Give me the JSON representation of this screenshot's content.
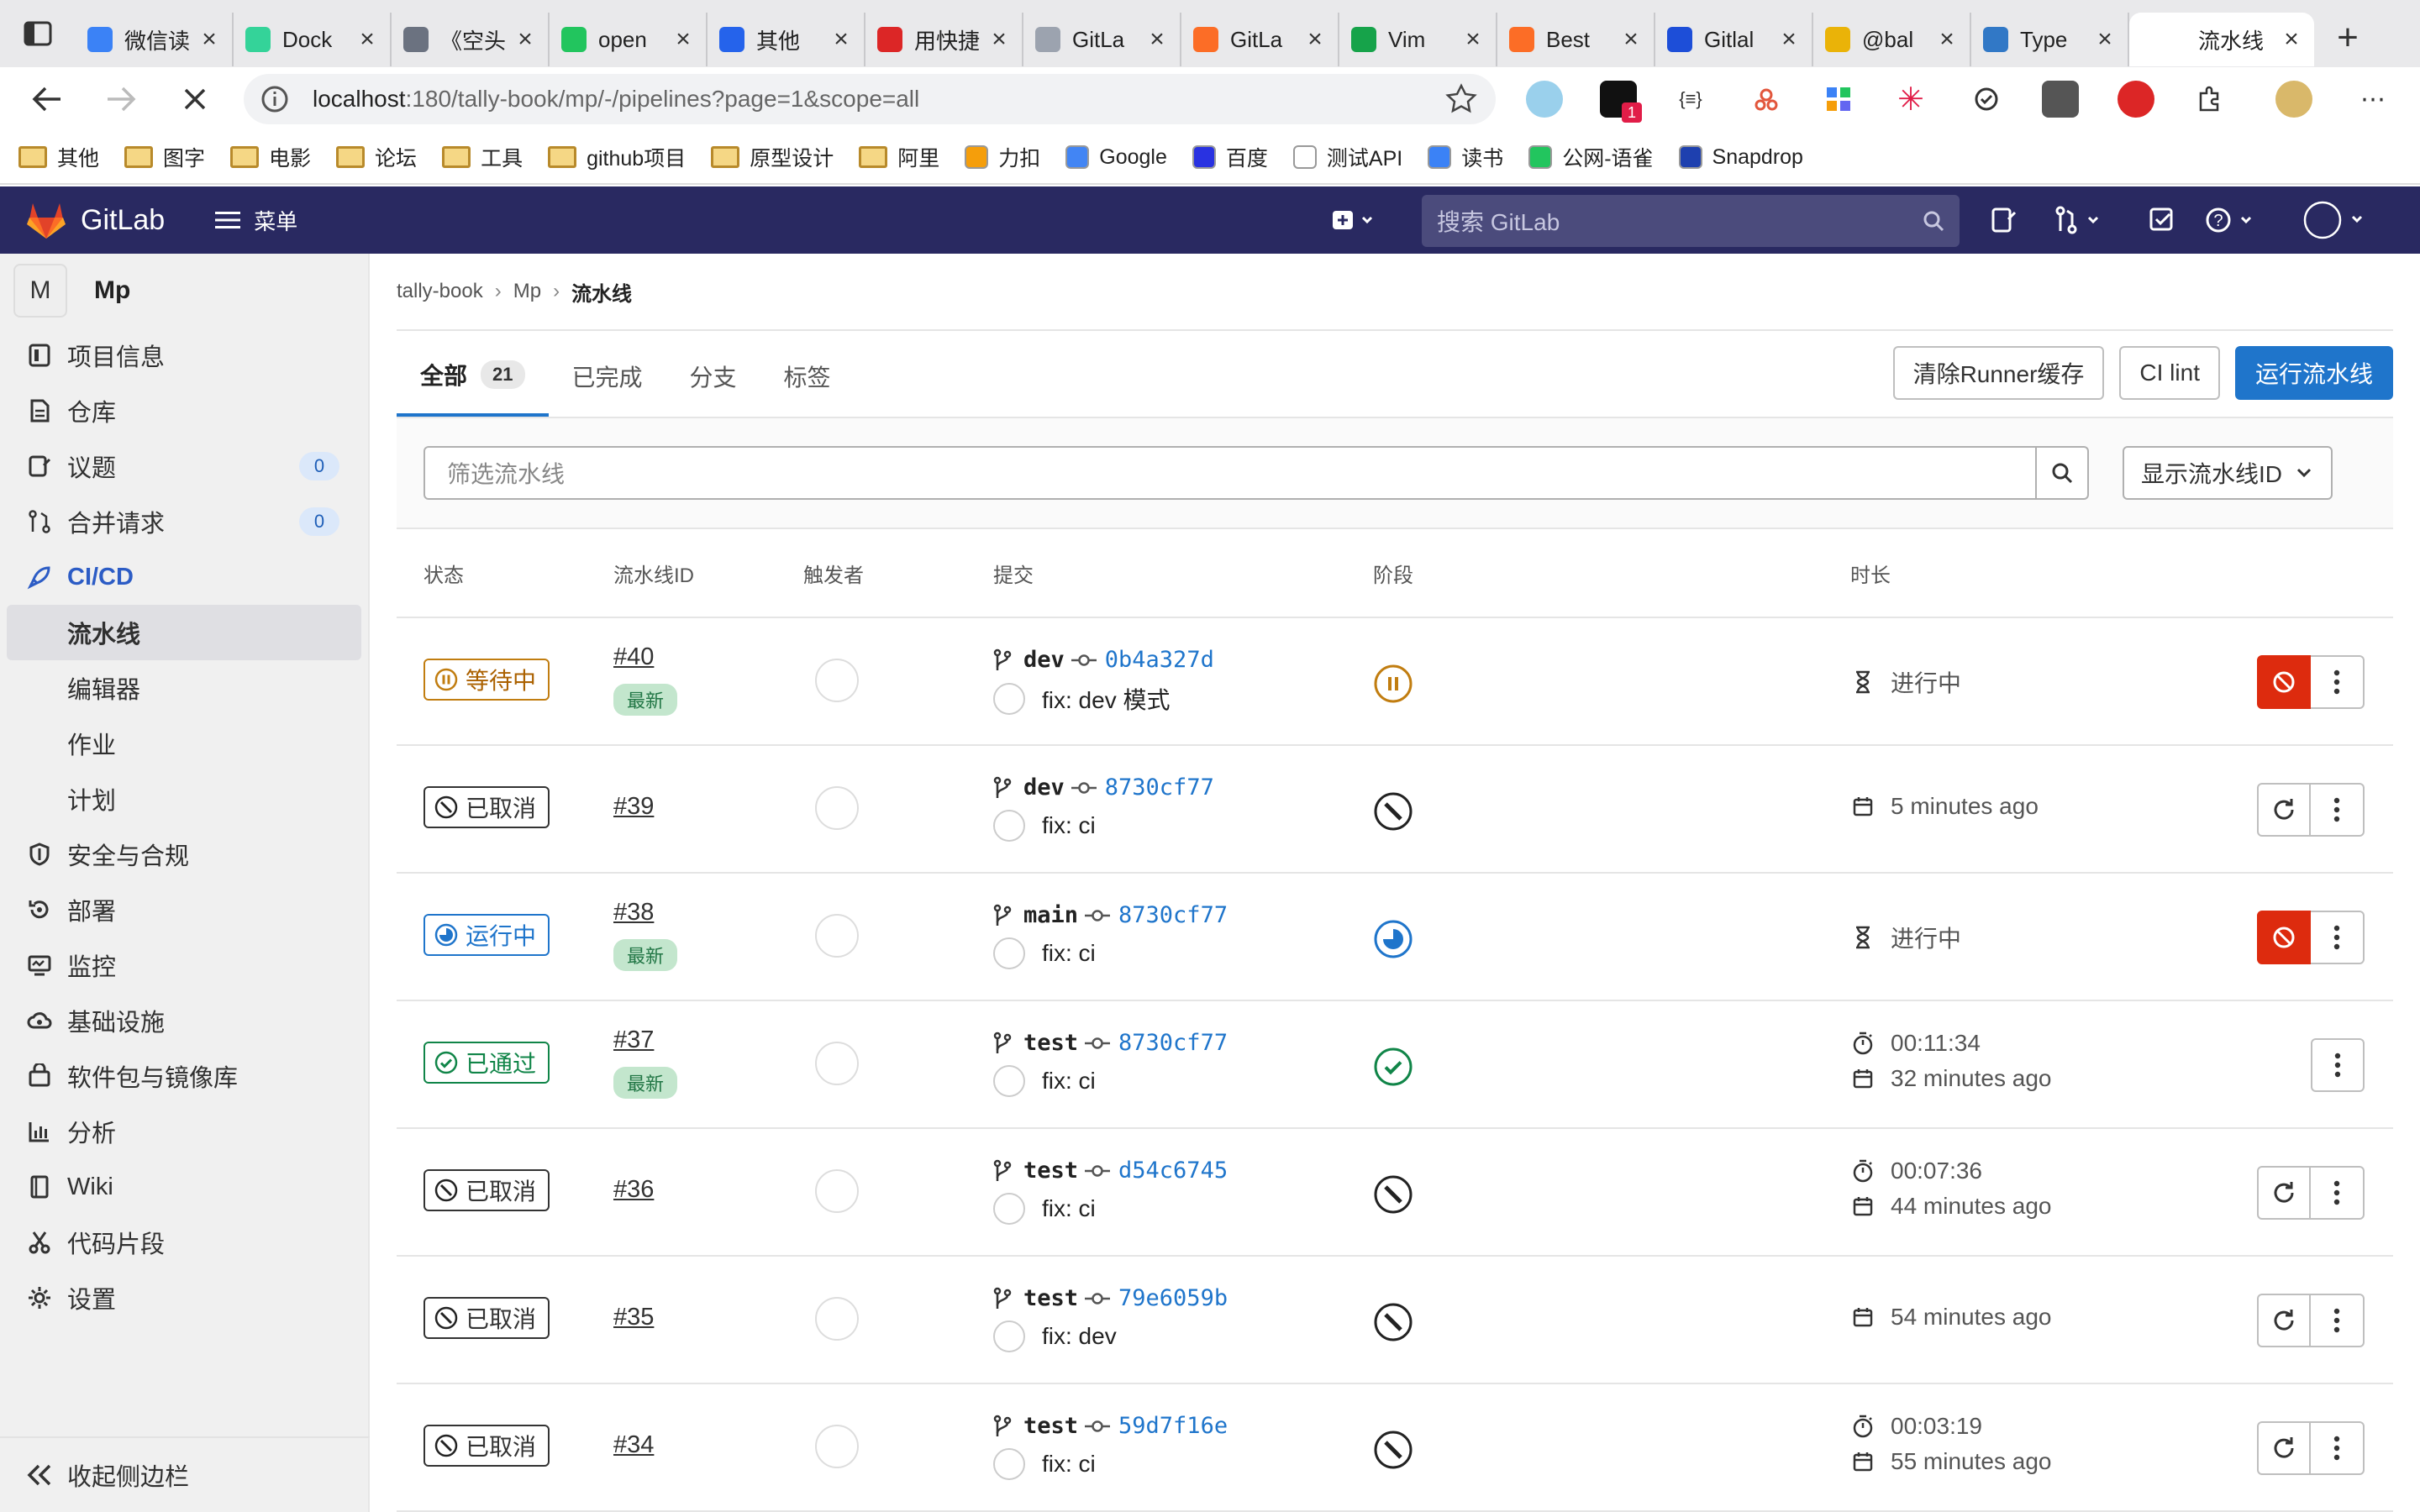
{
  "browser": {
    "tabs": [
      {
        "label": "微信读",
        "color": "#3b82f6"
      },
      {
        "label": "Dock",
        "color": "#34d399"
      },
      {
        "label": "《空头",
        "color": "#6b7280"
      },
      {
        "label": "open",
        "color": "#22c55e"
      },
      {
        "label": "其他",
        "color": "#2563eb"
      },
      {
        "label": "用快捷",
        "color": "#dc2626"
      },
      {
        "label": "GitLa",
        "color": "#9ca3af"
      },
      {
        "label": "GitLa",
        "color": "#fc6d26"
      },
      {
        "label": "Vim",
        "color": "#16a34a"
      },
      {
        "label": "Best",
        "color": "#fc6d26"
      },
      {
        "label": "Gitlal",
        "color": "#1d4ed8"
      },
      {
        "label": "@bal",
        "color": "#eab308"
      },
      {
        "label": "Type",
        "color": "#3178c6"
      }
    ],
    "active_tab": "流水线",
    "url_host": "localhost",
    "url_path": ":180/tally-book/mp/-/pipelines?page=1&scope=all",
    "bookmarks": [
      {
        "label": "其他",
        "type": "folder"
      },
      {
        "label": "图字",
        "type": "folder"
      },
      {
        "label": "电影",
        "type": "folder"
      },
      {
        "label": "论坛",
        "type": "folder"
      },
      {
        "label": "工具",
        "type": "folder"
      },
      {
        "label": "github项目",
        "type": "folder"
      },
      {
        "label": "原型设计",
        "type": "folder"
      },
      {
        "label": "阿里",
        "type": "folder"
      },
      {
        "label": "力扣",
        "type": "site",
        "color": "#f59e0b"
      },
      {
        "label": "Google",
        "type": "site",
        "color": "#4285f4"
      },
      {
        "label": "百度",
        "type": "site",
        "color": "#2932e1"
      },
      {
        "label": "测试API",
        "type": "site",
        "color": "#ffffff"
      },
      {
        "label": "读书",
        "type": "site",
        "color": "#3b82f6"
      },
      {
        "label": "公网-语雀",
        "type": "site",
        "color": "#22c55e"
      },
      {
        "label": "Snapdrop",
        "type": "site",
        "color": "#1e40af"
      }
    ],
    "extension_badge": "1"
  },
  "gitlab_nav": {
    "brand": "GitLab",
    "menu_label": "菜单",
    "search_placeholder": "搜索 GitLab"
  },
  "sidebar": {
    "project_initial": "M",
    "project_name": "Mp",
    "items": [
      {
        "label": "项目信息",
        "icon": "project-icon"
      },
      {
        "label": "仓库",
        "icon": "doc-icon"
      },
      {
        "label": "议题",
        "icon": "issues-icon",
        "count": "0"
      },
      {
        "label": "合并请求",
        "icon": "merge-icon",
        "count": "0"
      },
      {
        "label": "CI/CD",
        "icon": "rocket-icon"
      }
    ],
    "cicd_sub": [
      "流水线",
      "编辑器",
      "作业",
      "计划"
    ],
    "items2": [
      {
        "label": "安全与合规",
        "icon": "shield-icon"
      },
      {
        "label": "部署",
        "icon": "deploy-icon"
      },
      {
        "label": "监控",
        "icon": "monitor-icon"
      },
      {
        "label": "基础设施",
        "icon": "cloud-icon"
      },
      {
        "label": "软件包与镜像库",
        "icon": "package-icon"
      },
      {
        "label": "分析",
        "icon": "chart-icon"
      },
      {
        "label": "Wiki",
        "icon": "book-icon"
      },
      {
        "label": "代码片段",
        "icon": "snippet-icon"
      },
      {
        "label": "设置",
        "icon": "gear-icon"
      }
    ],
    "collapse_label": "收起侧边栏"
  },
  "breadcrumb": {
    "items": [
      "tally-book",
      "Mp"
    ],
    "current": "流水线"
  },
  "tabs": {
    "all": "全部",
    "all_count": "21",
    "finished": "已完成",
    "branches": "分支",
    "tags": "标签"
  },
  "actions": {
    "clear_cache": "清除Runner缓存",
    "ci_lint": "CI lint",
    "run_pipeline": "运行流水线"
  },
  "filter": {
    "placeholder": "筛选流水线",
    "display_option": "显示流水线ID"
  },
  "table": {
    "headers": {
      "status": "状态",
      "id": "流水线ID",
      "trigger": "触发者",
      "commit": "提交",
      "stages": "阶段",
      "duration": "时长"
    },
    "latest_label": "最新",
    "rows": [
      {
        "status": "pending",
        "status_label": "等待中",
        "id": "#40",
        "latest": true,
        "branch": "dev",
        "sha": "0b4a327d",
        "message": "fix: dev 模式",
        "duration": "",
        "time": "进行中",
        "time_icon": "hourglass",
        "action": "cancel"
      },
      {
        "status": "canceled",
        "status_label": "已取消",
        "id": "#39",
        "latest": false,
        "branch": "dev",
        "sha": "8730cf77",
        "message": "fix: ci",
        "duration": "",
        "time": "5 minutes ago",
        "time_icon": "calendar",
        "action": "retry"
      },
      {
        "status": "running",
        "status_label": "运行中",
        "id": "#38",
        "latest": true,
        "branch": "main",
        "sha": "8730cf77",
        "message": "fix: ci",
        "duration": "",
        "time": "进行中",
        "time_icon": "hourglass",
        "action": "cancel"
      },
      {
        "status": "passed",
        "status_label": "已通过",
        "id": "#37",
        "latest": true,
        "branch": "test",
        "sha": "8730cf77",
        "message": "fix: ci",
        "duration": "00:11:34",
        "time": "32 minutes ago",
        "time_icon": "calendar",
        "action": "none"
      },
      {
        "status": "canceled",
        "status_label": "已取消",
        "id": "#36",
        "latest": false,
        "branch": "test",
        "sha": "d54c6745",
        "message": "fix: ci",
        "duration": "00:07:36",
        "time": "44 minutes ago",
        "time_icon": "calendar",
        "action": "retry"
      },
      {
        "status": "canceled",
        "status_label": "已取消",
        "id": "#35",
        "latest": false,
        "branch": "test",
        "sha": "79e6059b",
        "message": "fix: dev",
        "duration": "",
        "time": "54 minutes ago",
        "time_icon": "calendar",
        "action": "retry"
      },
      {
        "status": "canceled",
        "status_label": "已取消",
        "id": "#34",
        "latest": false,
        "branch": "test",
        "sha": "59d7f16e",
        "message": "fix: ci",
        "duration": "00:03:19",
        "time": "55 minutes ago",
        "time_icon": "calendar",
        "action": "retry"
      }
    ]
  },
  "colors": {
    "nav_bg": "#292961",
    "primary": "#1f75cb",
    "danger": "#dd2b0e",
    "passed": "#108548",
    "pending": "#c17d10"
  }
}
